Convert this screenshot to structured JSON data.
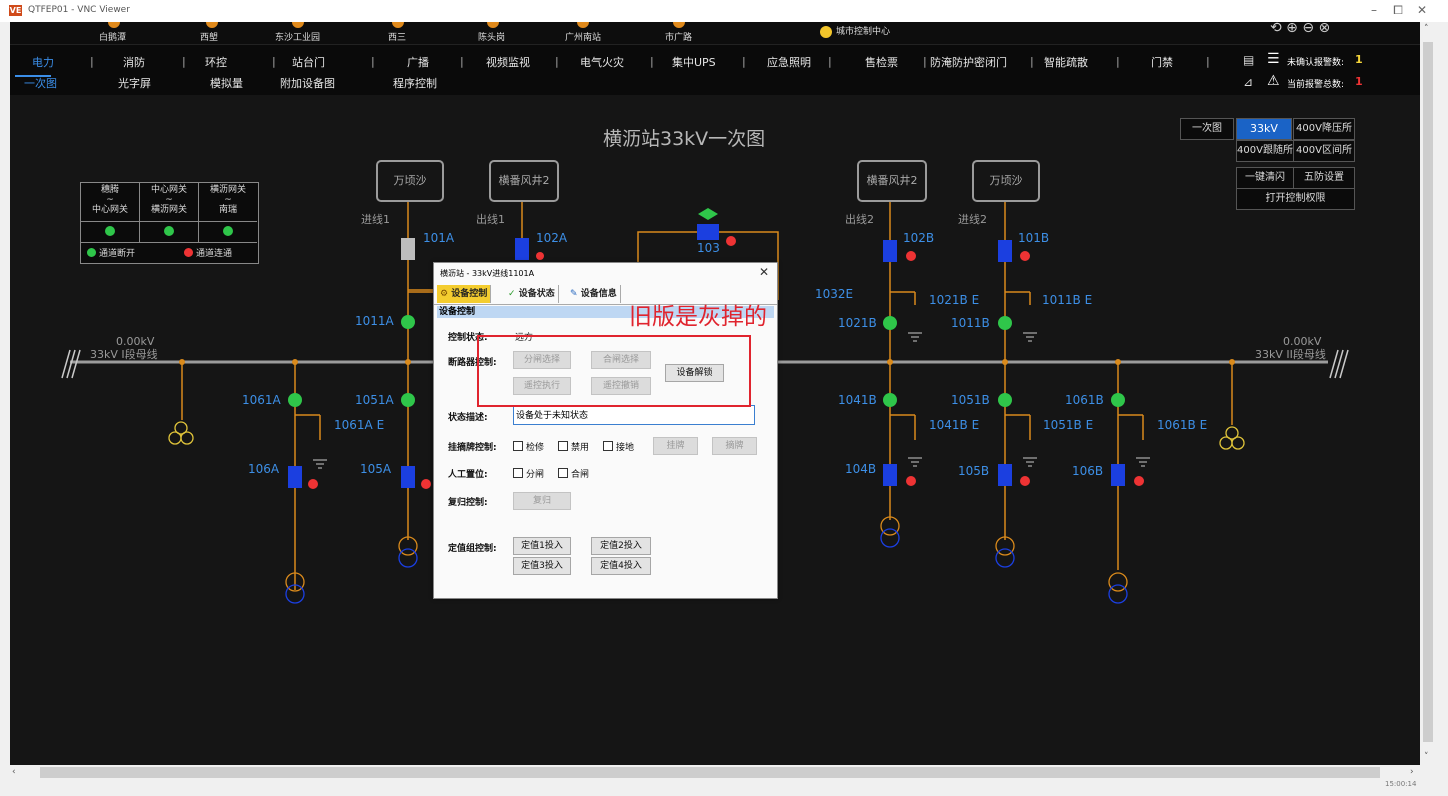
{
  "window": {
    "title": "QTFEP01 - VNC Viewer",
    "logo": "VE",
    "minimize": "–",
    "restore": "⧠",
    "close": "✕"
  },
  "stations": [
    "白鹅潭",
    "西塱",
    "东沙工业园",
    "西三",
    "陈头岗",
    "广州南站",
    "市广路",
    "城市控制中心"
  ],
  "nav": {
    "row1": [
      "电力",
      "消防",
      "环控",
      "站台门",
      "广播",
      "视频监视",
      "电气火灾",
      "集中UPS",
      "应急照明",
      "售检票",
      "防淹防护密闭门",
      "智能疏散",
      "门禁"
    ],
    "row2": [
      "一次图",
      "光字屏",
      "模拟量",
      "附加设备图",
      "程序控制"
    ]
  },
  "alarms": {
    "unconfirmed_label": "未确认报警数:",
    "unconfirmed_value": "1",
    "current_label": "当前报警总数:",
    "current_value": "1"
  },
  "diagram": {
    "title": "横沥站33kV一次图",
    "buttons": {
      "b1": "一次图",
      "b2": "33kV",
      "b3": "400V降压所",
      "b4": "400V跟随所",
      "b5": "400V区间所",
      "b6": "一键清闪",
      "b7": "五防设置",
      "b8": "打开控制权限"
    },
    "legend": {
      "h1": "穗腾\n~\n中心网关",
      "h2": "中心网关\n~\n横沥网关",
      "h3": "横沥网关\n~\n南瑞",
      "off": "通道断开",
      "on": "通道连通"
    },
    "boxes": {
      "b1": "万顷沙",
      "b2": "横番风井2",
      "b3": "横番风井2",
      "b4": "万顷沙"
    },
    "in1": "进线1",
    "out1": "出线1",
    "out2": "出线2",
    "in2": "进线2",
    "bus_left_value": "0.00kV",
    "bus_left_name": "33kV I段母线",
    "bus_right_value": "0.00kV",
    "bus_right_name": "33kV II段母线",
    "labels": {
      "l101A": "101A",
      "l102A": "102A",
      "l103": "103",
      "l102B": "102B",
      "l101B": "101B",
      "l1011A": "1011A",
      "l1032E": "1032E",
      "l1021BE": "1021B E",
      "l1011BE": "1011B E",
      "l1021B": "1021B",
      "l1011B": "1011B",
      "l1061A": "1061A",
      "l1051A": "1051A",
      "l1061AE": "1061A E",
      "l106A": "106A",
      "l105A": "105A",
      "l1041B": "1041B",
      "l1051B": "1051B",
      "l1061B": "1061B",
      "l1041BE": "1041B E",
      "l1051BE": "1051B E",
      "l1061BE": "1061B E",
      "l104B": "104B",
      "l105B": "105B",
      "l106B": "106B"
    }
  },
  "dialog": {
    "title": "横沥站 - 33kV进线1101A",
    "close": "✕",
    "tabs": [
      "设备控制",
      "设备状态",
      "设备信息"
    ],
    "section": "设备控制",
    "control_status_label": "控制状态:",
    "control_status_value": "远方",
    "breaker_label": "断路器控制:",
    "btn_open_sel": "分闸选择",
    "btn_close_sel": "合闸选择",
    "btn_remote_exec": "遥控执行",
    "btn_remote_cancel": "遥控撤销",
    "btn_unlock": "设备解锁",
    "state_desc_label": "状态描述:",
    "state_desc_value": "设备处于未知状态",
    "tag_label": "挂摘牌控制:",
    "tag_opts": [
      "检修",
      "禁用",
      "接地"
    ],
    "btn_tag": "挂牌",
    "btn_untag": "摘牌",
    "manual_label": "人工置位:",
    "manual_opts": [
      "分闸",
      "合闸"
    ],
    "reset_label": "复归控制:",
    "btn_reset": "复归",
    "setting_label": "定值组控制:",
    "setting_btns": [
      "定值1投入",
      "定值2投入",
      "定值3投入",
      "定值4投入"
    ]
  },
  "annotation": "旧版是灰掉的",
  "statusbar": {
    "time": "15:00:14"
  },
  "colors": {
    "accent": "#3b8ee8",
    "closed_breaker": "#1b3fe0",
    "open_breaker": "#bdbdbd",
    "green": "#2fc64a",
    "red": "#ee3334",
    "wire": "#d98a1c",
    "note": "#e0242e"
  }
}
